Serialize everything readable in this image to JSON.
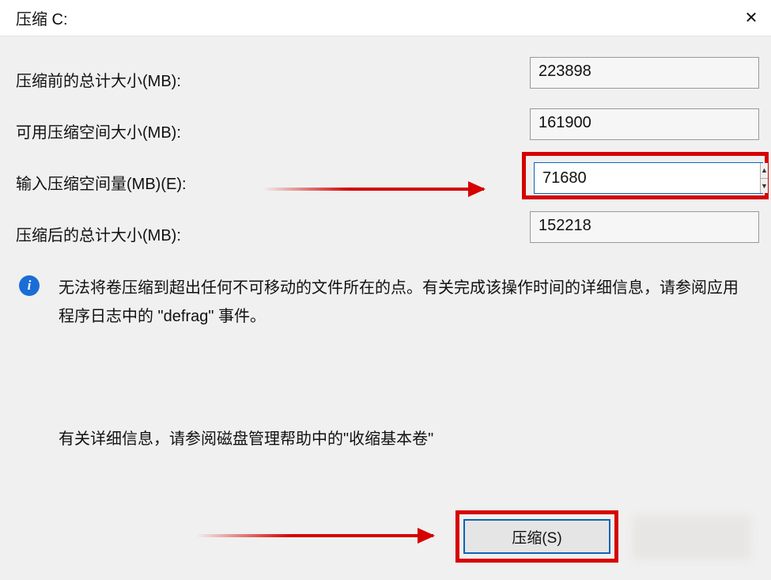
{
  "title": "压缩 C:",
  "labels": {
    "total_before": "压缩前的总计大小(MB):",
    "available": "可用压缩空间大小(MB):",
    "enter_amount": "输入压缩空间量(MB)(E):",
    "total_after": "压缩后的总计大小(MB):"
  },
  "values": {
    "total_before": "223898",
    "available": "161900",
    "enter_amount": "71680",
    "total_after": "152218"
  },
  "info_text": "无法将卷压缩到超出任何不可移动的文件所在的点。有关完成该操作时间的详细信息，请参阅应用程序日志中的 \"defrag\" 事件。",
  "help_text": "有关详细信息，请参阅磁盘管理帮助中的\"收缩基本卷\"",
  "buttons": {
    "shrink": "压缩(S)"
  },
  "icons": {
    "info": "i",
    "close": "✕",
    "up": "▲",
    "down": "▼"
  }
}
